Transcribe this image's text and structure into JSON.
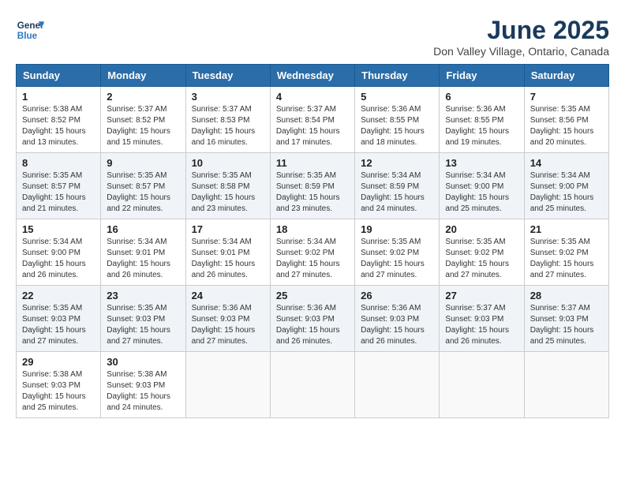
{
  "header": {
    "logo_line1": "General",
    "logo_line2": "Blue",
    "month": "June 2025",
    "location": "Don Valley Village, Ontario, Canada"
  },
  "weekdays": [
    "Sunday",
    "Monday",
    "Tuesday",
    "Wednesday",
    "Thursday",
    "Friday",
    "Saturday"
  ],
  "weeks": [
    [
      {
        "day": "1",
        "lines": [
          "Sunrise: 5:38 AM",
          "Sunset: 8:52 PM",
          "Daylight: 15 hours",
          "and 13 minutes."
        ]
      },
      {
        "day": "2",
        "lines": [
          "Sunrise: 5:37 AM",
          "Sunset: 8:52 PM",
          "Daylight: 15 hours",
          "and 15 minutes."
        ]
      },
      {
        "day": "3",
        "lines": [
          "Sunrise: 5:37 AM",
          "Sunset: 8:53 PM",
          "Daylight: 15 hours",
          "and 16 minutes."
        ]
      },
      {
        "day": "4",
        "lines": [
          "Sunrise: 5:37 AM",
          "Sunset: 8:54 PM",
          "Daylight: 15 hours",
          "and 17 minutes."
        ]
      },
      {
        "day": "5",
        "lines": [
          "Sunrise: 5:36 AM",
          "Sunset: 8:55 PM",
          "Daylight: 15 hours",
          "and 18 minutes."
        ]
      },
      {
        "day": "6",
        "lines": [
          "Sunrise: 5:36 AM",
          "Sunset: 8:55 PM",
          "Daylight: 15 hours",
          "and 19 minutes."
        ]
      },
      {
        "day": "7",
        "lines": [
          "Sunrise: 5:35 AM",
          "Sunset: 8:56 PM",
          "Daylight: 15 hours",
          "and 20 minutes."
        ]
      }
    ],
    [
      {
        "day": "8",
        "lines": [
          "Sunrise: 5:35 AM",
          "Sunset: 8:57 PM",
          "Daylight: 15 hours",
          "and 21 minutes."
        ]
      },
      {
        "day": "9",
        "lines": [
          "Sunrise: 5:35 AM",
          "Sunset: 8:57 PM",
          "Daylight: 15 hours",
          "and 22 minutes."
        ]
      },
      {
        "day": "10",
        "lines": [
          "Sunrise: 5:35 AM",
          "Sunset: 8:58 PM",
          "Daylight: 15 hours",
          "and 23 minutes."
        ]
      },
      {
        "day": "11",
        "lines": [
          "Sunrise: 5:35 AM",
          "Sunset: 8:59 PM",
          "Daylight: 15 hours",
          "and 23 minutes."
        ]
      },
      {
        "day": "12",
        "lines": [
          "Sunrise: 5:34 AM",
          "Sunset: 8:59 PM",
          "Daylight: 15 hours",
          "and 24 minutes."
        ]
      },
      {
        "day": "13",
        "lines": [
          "Sunrise: 5:34 AM",
          "Sunset: 9:00 PM",
          "Daylight: 15 hours",
          "and 25 minutes."
        ]
      },
      {
        "day": "14",
        "lines": [
          "Sunrise: 5:34 AM",
          "Sunset: 9:00 PM",
          "Daylight: 15 hours",
          "and 25 minutes."
        ]
      }
    ],
    [
      {
        "day": "15",
        "lines": [
          "Sunrise: 5:34 AM",
          "Sunset: 9:00 PM",
          "Daylight: 15 hours",
          "and 26 minutes."
        ]
      },
      {
        "day": "16",
        "lines": [
          "Sunrise: 5:34 AM",
          "Sunset: 9:01 PM",
          "Daylight: 15 hours",
          "and 26 minutes."
        ]
      },
      {
        "day": "17",
        "lines": [
          "Sunrise: 5:34 AM",
          "Sunset: 9:01 PM",
          "Daylight: 15 hours",
          "and 26 minutes."
        ]
      },
      {
        "day": "18",
        "lines": [
          "Sunrise: 5:34 AM",
          "Sunset: 9:02 PM",
          "Daylight: 15 hours",
          "and 27 minutes."
        ]
      },
      {
        "day": "19",
        "lines": [
          "Sunrise: 5:35 AM",
          "Sunset: 9:02 PM",
          "Daylight: 15 hours",
          "and 27 minutes."
        ]
      },
      {
        "day": "20",
        "lines": [
          "Sunrise: 5:35 AM",
          "Sunset: 9:02 PM",
          "Daylight: 15 hours",
          "and 27 minutes."
        ]
      },
      {
        "day": "21",
        "lines": [
          "Sunrise: 5:35 AM",
          "Sunset: 9:02 PM",
          "Daylight: 15 hours",
          "and 27 minutes."
        ]
      }
    ],
    [
      {
        "day": "22",
        "lines": [
          "Sunrise: 5:35 AM",
          "Sunset: 9:03 PM",
          "Daylight: 15 hours",
          "and 27 minutes."
        ]
      },
      {
        "day": "23",
        "lines": [
          "Sunrise: 5:35 AM",
          "Sunset: 9:03 PM",
          "Daylight: 15 hours",
          "and 27 minutes."
        ]
      },
      {
        "day": "24",
        "lines": [
          "Sunrise: 5:36 AM",
          "Sunset: 9:03 PM",
          "Daylight: 15 hours",
          "and 27 minutes."
        ]
      },
      {
        "day": "25",
        "lines": [
          "Sunrise: 5:36 AM",
          "Sunset: 9:03 PM",
          "Daylight: 15 hours",
          "and 26 minutes."
        ]
      },
      {
        "day": "26",
        "lines": [
          "Sunrise: 5:36 AM",
          "Sunset: 9:03 PM",
          "Daylight: 15 hours",
          "and 26 minutes."
        ]
      },
      {
        "day": "27",
        "lines": [
          "Sunrise: 5:37 AM",
          "Sunset: 9:03 PM",
          "Daylight: 15 hours",
          "and 26 minutes."
        ]
      },
      {
        "day": "28",
        "lines": [
          "Sunrise: 5:37 AM",
          "Sunset: 9:03 PM",
          "Daylight: 15 hours",
          "and 25 minutes."
        ]
      }
    ],
    [
      {
        "day": "29",
        "lines": [
          "Sunrise: 5:38 AM",
          "Sunset: 9:03 PM",
          "Daylight: 15 hours",
          "and 25 minutes."
        ]
      },
      {
        "day": "30",
        "lines": [
          "Sunrise: 5:38 AM",
          "Sunset: 9:03 PM",
          "Daylight: 15 hours",
          "and 24 minutes."
        ]
      },
      {
        "day": "",
        "lines": []
      },
      {
        "day": "",
        "lines": []
      },
      {
        "day": "",
        "lines": []
      },
      {
        "day": "",
        "lines": []
      },
      {
        "day": "",
        "lines": []
      }
    ]
  ]
}
